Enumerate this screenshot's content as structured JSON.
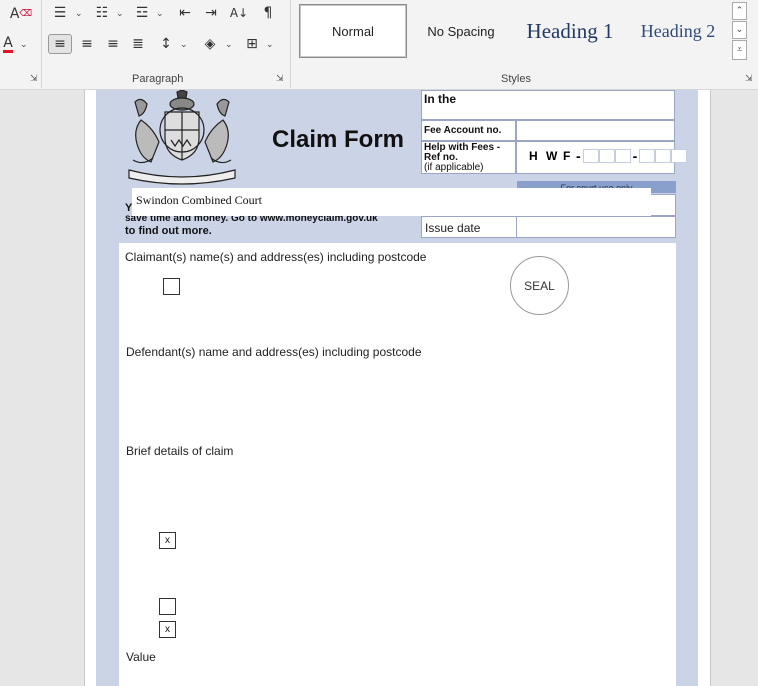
{
  "ribbon": {
    "paragraph_label": "Paragraph",
    "styles_label": "Styles",
    "styles": [
      {
        "label": "Normal"
      },
      {
        "label": "No Spacing"
      },
      {
        "label": "Heading 1"
      },
      {
        "label": "Heading 2"
      }
    ],
    "accent_color": "#e81123"
  },
  "form": {
    "title": "Claim Form",
    "in_the": "In the",
    "fee_account": "Fee Account no.",
    "hwf_label_1": "Help with Fees -",
    "hwf_label_2": "Ref no.",
    "hwf_label_3": "(if applicable)",
    "hwf_letters": [
      "H",
      "W",
      "F"
    ],
    "court_use_only": "For court use only",
    "court_name": "Swindon Combined Court",
    "online_line_1": "Y",
    "online_line_2": "save time and money. Go to www.moneyclaim.gov.uk",
    "online_line_3": "to find out more.",
    "issue_date": "Issue date",
    "claimant_label": "Claimant(s) name(s) and address(es) including postcode",
    "seal": "SEAL",
    "defendant_label": "Defendant(s) name and address(es) including postcode",
    "brief_label": "Brief details of claim",
    "check_x": "x",
    "value_label": "Value"
  }
}
